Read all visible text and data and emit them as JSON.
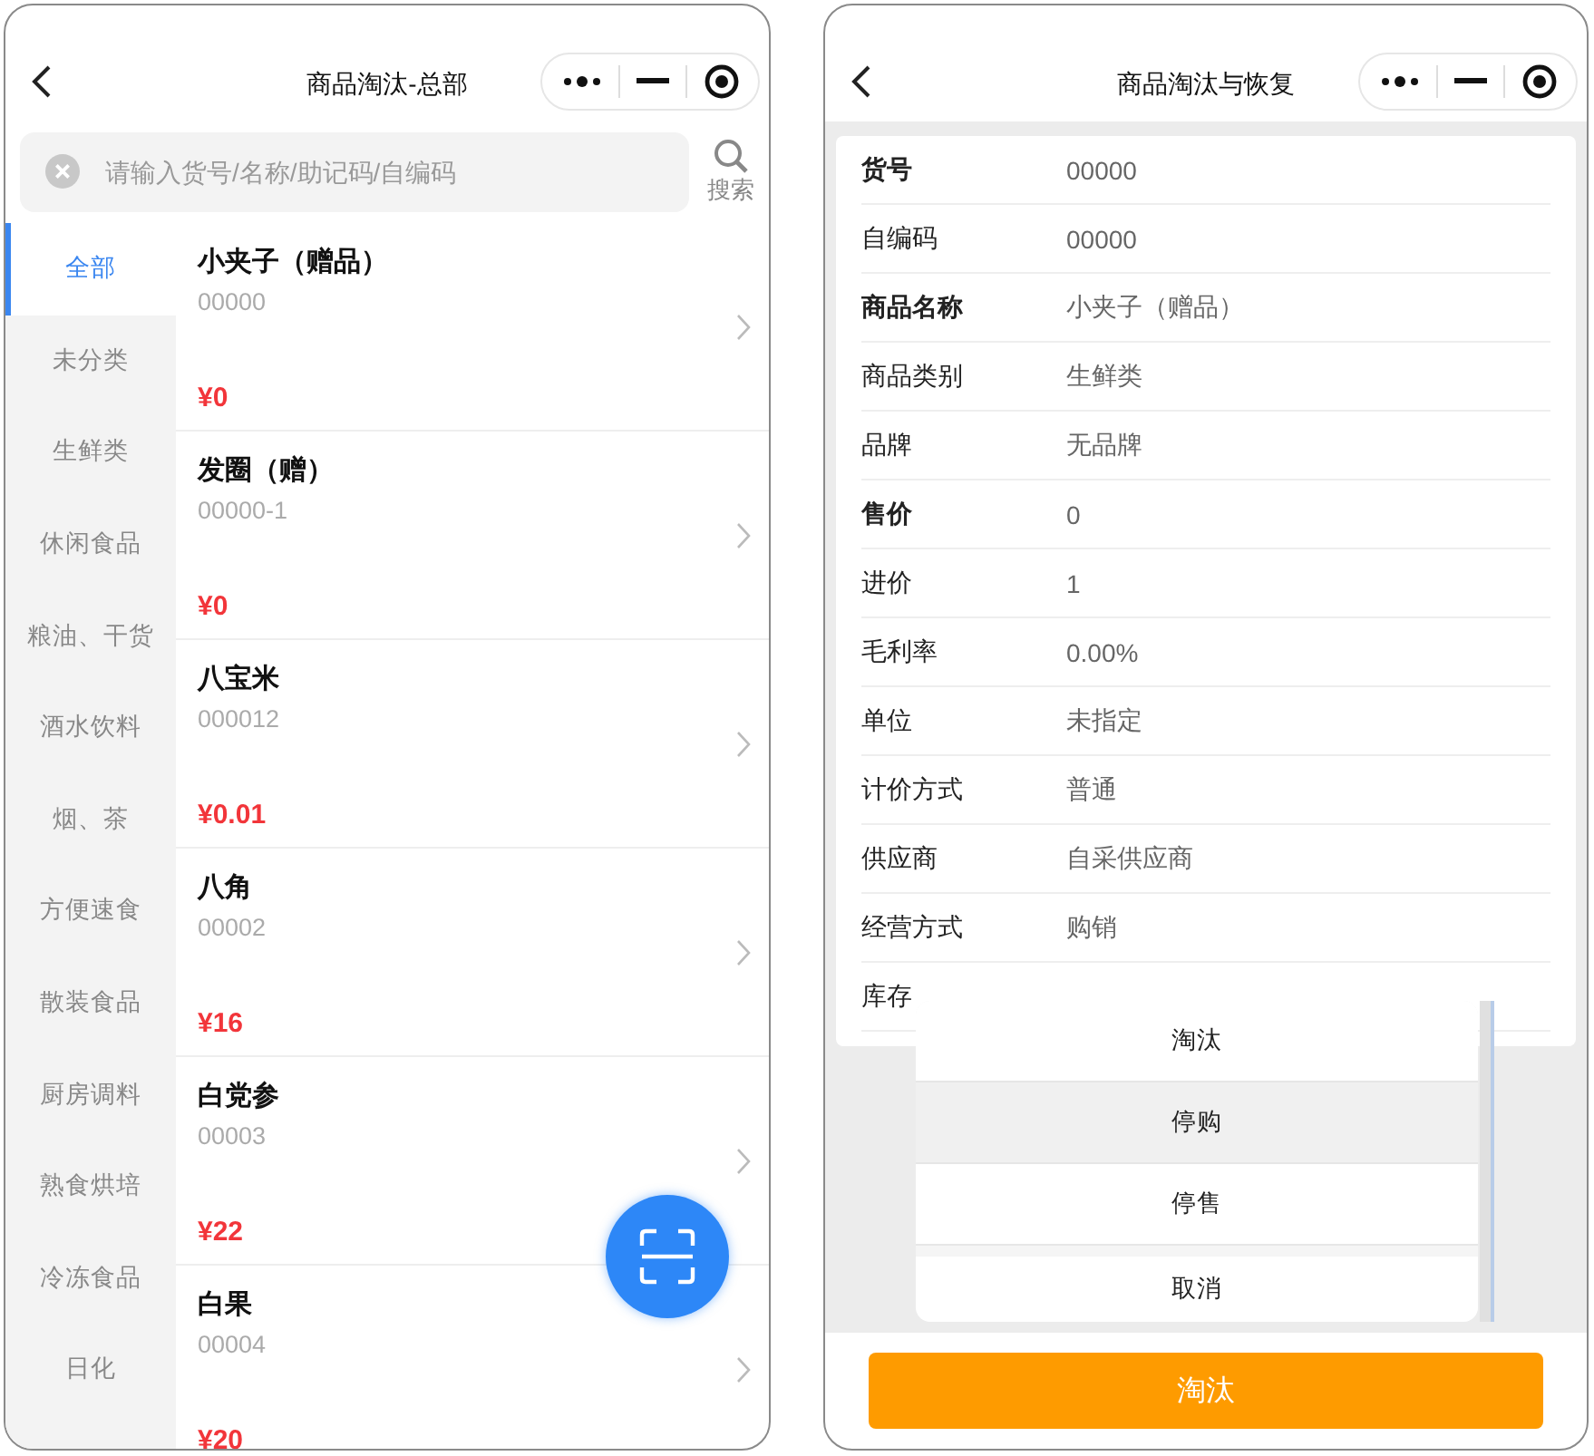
{
  "left": {
    "title": "商品淘汰-总部",
    "search": {
      "placeholder": "请输入货号/名称/助记码/自编码",
      "button": "搜索"
    },
    "categories": [
      {
        "label": "全部",
        "selected": true
      },
      {
        "label": "未分类",
        "selected": false
      },
      {
        "label": "生鲜类",
        "selected": false
      },
      {
        "label": "休闲食品",
        "selected": false
      },
      {
        "label": "粮油、干货",
        "selected": false
      },
      {
        "label": "酒水饮料",
        "selected": false
      },
      {
        "label": "烟、茶",
        "selected": false
      },
      {
        "label": "方便速食",
        "selected": false
      },
      {
        "label": "散装食品",
        "selected": false
      },
      {
        "label": "厨房调料",
        "selected": false
      },
      {
        "label": "熟食烘培",
        "selected": false
      },
      {
        "label": "冷冻食品",
        "selected": false
      },
      {
        "label": "日化",
        "selected": false
      }
    ],
    "products": [
      {
        "name": "小夹子（赠品）",
        "code": "00000",
        "price": "¥0"
      },
      {
        "name": "发圈（赠）",
        "code": "00000-1",
        "price": "¥0"
      },
      {
        "name": "八宝米",
        "code": "000012",
        "price": "¥0.01"
      },
      {
        "name": "八角",
        "code": "00002",
        "price": "¥16"
      },
      {
        "name": "白党参",
        "code": "00003",
        "price": "¥22"
      },
      {
        "name": "白果",
        "code": "00004",
        "price": "¥20"
      }
    ]
  },
  "right": {
    "title": "商品淘汰与恢复",
    "fields": [
      {
        "label": "货号",
        "value": "00000",
        "bold": true
      },
      {
        "label": "自编码",
        "value": "00000",
        "bold": false
      },
      {
        "label": "商品名称",
        "value": "小夹子（赠品）",
        "bold": true
      },
      {
        "label": "商品类别",
        "value": "生鲜类",
        "bold": false
      },
      {
        "label": "品牌",
        "value": "无品牌",
        "bold": false
      },
      {
        "label": "售价",
        "value": "0",
        "bold": true
      },
      {
        "label": "进价",
        "value": "1",
        "bold": false
      },
      {
        "label": "毛利率",
        "value": "0.00%",
        "bold": false
      },
      {
        "label": "单位",
        "value": "未指定",
        "bold": false
      },
      {
        "label": "计价方式",
        "value": "普通",
        "bold": false
      },
      {
        "label": "供应商",
        "value": "自采供应商",
        "bold": false
      },
      {
        "label": "经营方式",
        "value": "购销",
        "bold": false
      },
      {
        "label": "库存",
        "bold": false
      }
    ],
    "action_sheet": {
      "options": [
        {
          "label": "淘汰",
          "selected": false
        },
        {
          "label": "停购",
          "selected": true
        },
        {
          "label": "停售",
          "selected": false
        }
      ],
      "cancel": "取消"
    },
    "primary_button": "淘汰"
  }
}
